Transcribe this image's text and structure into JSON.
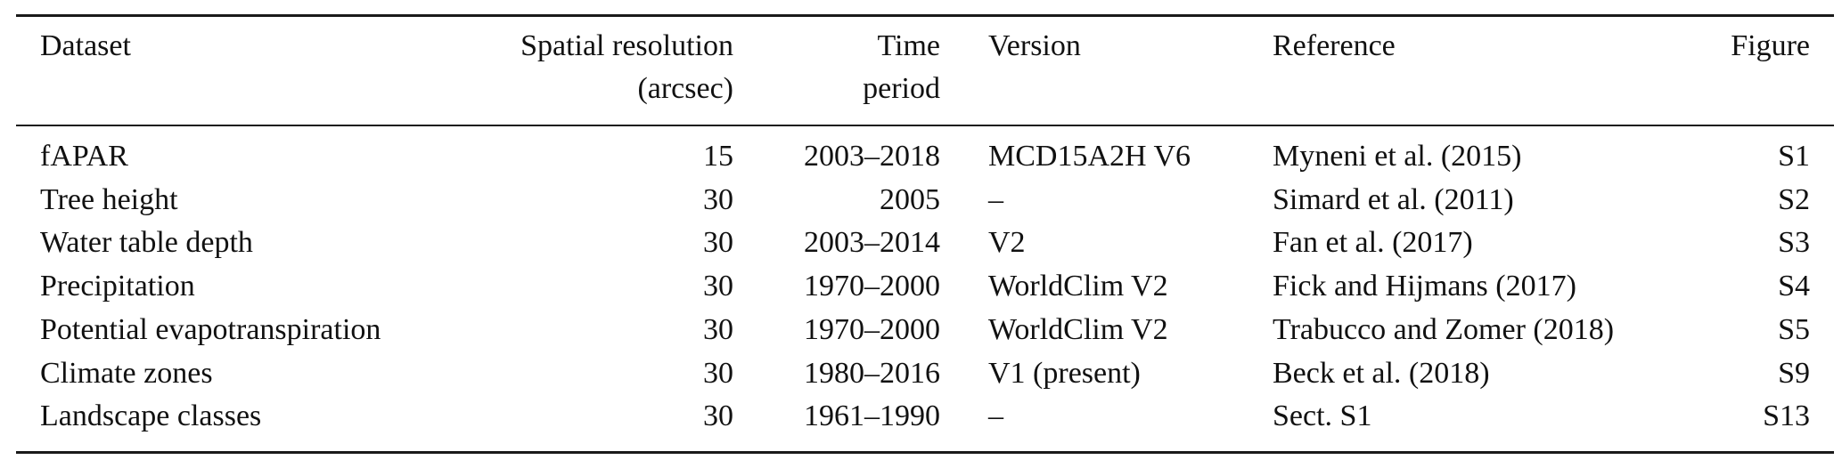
{
  "table": {
    "headers": {
      "dataset": "Dataset",
      "spatial_resolution": [
        "Spatial resolution",
        "(arcsec)"
      ],
      "time_period": [
        "Time",
        "period"
      ],
      "version": "Version",
      "reference": "Reference",
      "figure": "Figure"
    },
    "rows": [
      {
        "dataset": "fAPAR",
        "resolution": "15",
        "period": "2003–2018",
        "version": "MCD15A2H V6",
        "reference": "Myneni et al. (2015)",
        "figure": "S1"
      },
      {
        "dataset": "Tree height",
        "resolution": "30",
        "period": "2005",
        "version": "–",
        "reference": "Simard et al. (2011)",
        "figure": "S2"
      },
      {
        "dataset": "Water table depth",
        "resolution": "30",
        "period": "2003–2014",
        "version": "V2",
        "reference": "Fan et al. (2017)",
        "figure": "S3"
      },
      {
        "dataset": "Precipitation",
        "resolution": "30",
        "period": "1970–2000",
        "version": "WorldClim V2",
        "reference": "Fick and Hijmans (2017)",
        "figure": "S4"
      },
      {
        "dataset": "Potential evapotranspiration",
        "resolution": "30",
        "period": "1970–2000",
        "version": "WorldClim V2",
        "reference": "Trabucco and Zomer (2018)",
        "figure": "S5"
      },
      {
        "dataset": "Climate zones",
        "resolution": "30",
        "period": "1980–2016",
        "version": "V1 (present)",
        "reference": "Beck et al. (2018)",
        "figure": "S9"
      },
      {
        "dataset": "Landscape classes",
        "resolution": "30",
        "period": "1961–1990",
        "version": "–",
        "reference": "Sect. S1",
        "figure": "S13"
      }
    ]
  }
}
